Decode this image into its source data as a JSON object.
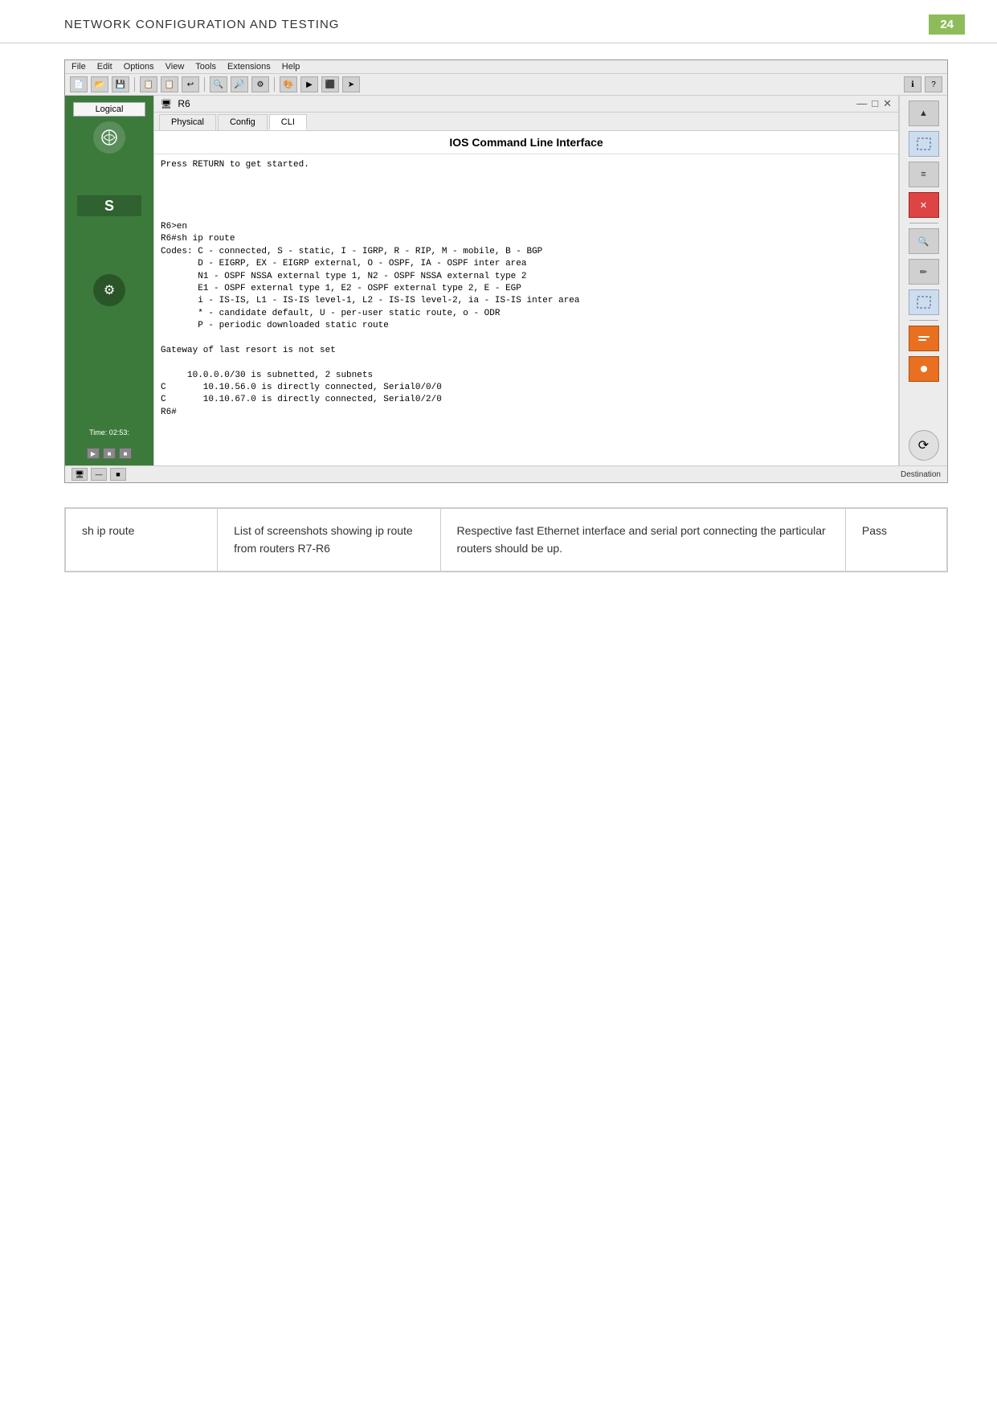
{
  "page": {
    "title": "NETWORK CONFIGURATION AND TESTING",
    "number": "24"
  },
  "menubar": {
    "items": [
      "File",
      "Edit",
      "Options",
      "View",
      "Tools",
      "Extensions",
      "Help"
    ]
  },
  "window": {
    "title": "R6",
    "tabs": [
      "Physical",
      "Config",
      "CLI"
    ],
    "active_tab": "CLI",
    "cli_header": "IOS Command Line Interface"
  },
  "terminal": {
    "content": "Press RETURN to get started.\n\n\n\n\nR6>en\nR6#sh ip route\nCodes: C - connected, S - static, I - IGRP, R - RIP, M - mobile, B - BGP\n       D - EIGRP, EX - EIGRP external, O - OSPF, IA - OSPF inter area\n       N1 - OSPF NSSA external type 1, N2 - OSPF NSSA external type 2\n       E1 - OSPF external type 1, E2 - OSPF external type 2, E - EGP\n       i - IS-IS, L1 - IS-IS level-1, L2 - IS-IS level-2, ia - IS-IS inter area\n       * - candidate default, U - per-user static route, o - ODR\n       P - periodic downloaded static route\n\nGateway of last resort is not set\n\n     10.0.0.0/30 is subnetted, 2 subnets\nC       10.10.56.0 is directly connected, Serial0/0/0\nC       10.10.67.0 is directly connected, Serial0/2/0\nR6#"
  },
  "sidebar": {
    "top_button": "Logical",
    "time_label": "Time: 02:53:",
    "s_label": "S"
  },
  "right_panel": {
    "icons": [
      "▶",
      "⟳",
      "↑",
      "?",
      "🔍",
      "✎",
      "⊞"
    ]
  },
  "bottom": {
    "destination_label": "Destination"
  },
  "table": {
    "rows": [
      {
        "command": "sh ip route",
        "list_desc": "List of screenshots showing ip route from routers R7-R6",
        "interface_desc": "Respective fast Ethernet interface and serial port connecting the particular routers should be up.",
        "result": "Pass"
      }
    ]
  }
}
